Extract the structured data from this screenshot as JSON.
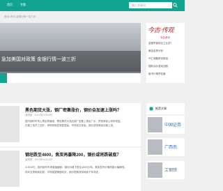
{
  "header": {
    "nav": [
      "首页",
      "专题"
    ],
    "search_placeholder": "输入关键词"
  },
  "breadcrumb": "首页>资讯 金融行情一览三折",
  "banner": {
    "title": "急加美国对政策 金银行情一波三折"
  },
  "sidebar": {
    "logo_text": "今古·传观",
    "subtitle": "今日资讯",
    "links": [
      "金银早盘前后之比多？",
      "黄金走势分析",
      "外汇储备再创新高",
      "国际油价波动加剧",
      "股市行情早知道"
    ]
  },
  "articles": [
    {
      "title": "黑色期货大涨，钢厂密集涨价，钢价会加速上涨吗？",
      "meta": "谢成航 · 2021年11月15日",
      "lines": [
        "国内钢材市场上周走势偏强，黑色期货大涨后钢厂密集上调出厂价，贸易商信心有所恢复。",
        "在建工地开工回升，采购积极性明显提高，市场成交放量，钢价或将继续加速上涨。"
      ]
    },
    {
      "title": "钢坯跌至4600，焦炭再暴降200，钢价或将跌破底？",
      "meta": "谢成航 · 2021年11月15日",
      "lines": [
        "11月15日，国内钢材市场普遍偏弱，钢坯价格下跌至4600元/吨，焦炭现货价格再度大幅降低。",
        "成本支撑继续走弱，市场观望情绪较浓，钢价短期或将继续下探寻底。"
      ]
    }
  ],
  "hot": {
    "title": "推荐文章",
    "items": [
      "中国证券",
      "广西南",
      "江钢铁"
    ]
  },
  "colors": {
    "accent": "#11a591",
    "logo": "#c8202a",
    "link": "#3b6fb0"
  }
}
